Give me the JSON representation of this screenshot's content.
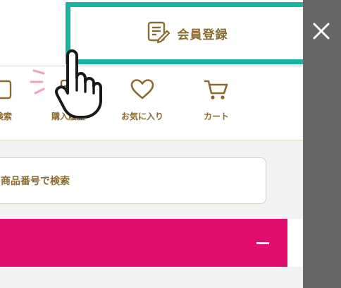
{
  "header": {
    "register_label": "会員登録"
  },
  "nav": {
    "items": [
      {
        "label": "検索",
        "icon": "search-icon"
      },
      {
        "label": "購入履歴",
        "icon": "history-icon"
      },
      {
        "label": "お気に入り",
        "icon": "heart-icon"
      },
      {
        "label": "カート",
        "icon": "cart-icon"
      }
    ]
  },
  "search": {
    "placeholder": "商品番号で検索"
  },
  "colors": {
    "accent_teal": "#17b3a3",
    "brand_gold": "#8a6a2f",
    "accent_pink": "#e20e6e",
    "overlay_gray": "#666666"
  }
}
